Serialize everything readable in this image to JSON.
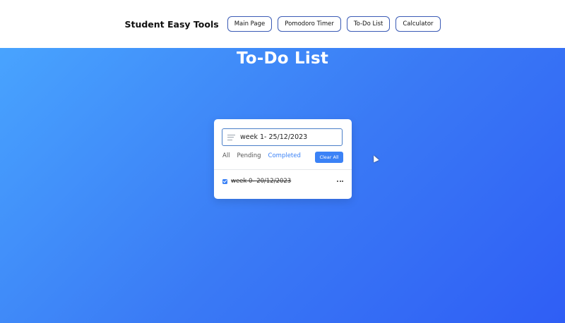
{
  "header": {
    "brand": "Student Easy Tools",
    "nav": [
      "Main Page",
      "Pomodoro Timer",
      "To-Do List",
      "Calculator"
    ]
  },
  "page": {
    "title": "To-Do List"
  },
  "todo": {
    "input_value": "week 1- 25/12/2023",
    "filters": [
      "All",
      "Pending",
      "Completed"
    ],
    "active_filter": "Completed",
    "clear_label": "Clear All",
    "tasks": [
      {
        "text": "week 0- 20/12/2023",
        "completed": true
      }
    ]
  },
  "colors": {
    "accent": "#3b82f6",
    "nav_border": "#3b5bb5",
    "gradient_start": "#4aa8ff",
    "gradient_end": "#2f5ef5"
  }
}
